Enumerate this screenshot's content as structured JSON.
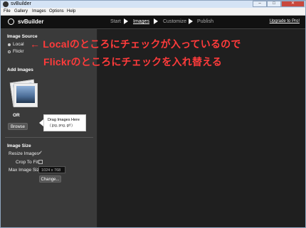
{
  "window": {
    "title": "svBuilder"
  },
  "menu": {
    "items": [
      "File",
      "Gallery",
      "Images",
      "Options",
      "Help"
    ]
  },
  "header": {
    "logo_text": "svBuilder",
    "steps": [
      "Start",
      "Images",
      "Customize",
      "Publish"
    ],
    "active_step": "Images",
    "upgrade_label": "Upgrade to Pro!"
  },
  "left_panel": {
    "image_source_title": "Image Source",
    "source_local": "Local",
    "source_flickr": "Flickr",
    "add_images_title": "Add Images",
    "drop_hint_title": "Drag Images Here",
    "drop_hint_types": "( jpg, png, gif )",
    "or_label": "OR",
    "browse_label": "Browse",
    "image_size_title": "Image Size",
    "resize_label": "Resize Images",
    "crop_label": "Crop To Fit",
    "max_size_label": "Max Image Size",
    "max_size_value": "1024 x 768",
    "change_label": "Change..."
  },
  "annotation": {
    "line1": "← Localのところにチェックが入っているので",
    "line2": "Flickrのところにチェックを入れ替える"
  },
  "colors": {
    "annotation": "#ff3b3b",
    "header_bg": "#111111",
    "panel_bg": "#3a3a3a"
  }
}
